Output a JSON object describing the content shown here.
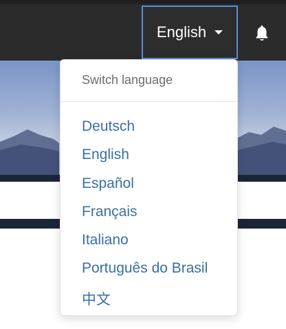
{
  "navbar": {
    "current_language": "English",
    "icons": {
      "caret": "caret-down-icon",
      "notifications": "bell-icon"
    }
  },
  "dropdown": {
    "header": "Switch language",
    "languages": [
      "Deutsch",
      "English",
      "Español",
      "Français",
      "Italiano",
      "Português do Brasil",
      "中文"
    ]
  },
  "colors": {
    "navbar": "#2b2b2b",
    "link": "#3a6ea5",
    "focus_outline": "#5b8fd8",
    "dark_band": "#1c2537"
  }
}
